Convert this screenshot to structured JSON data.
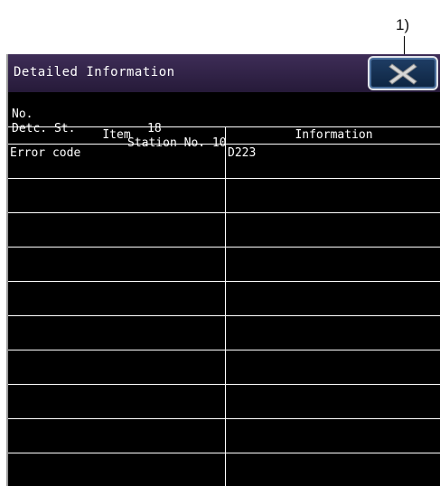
{
  "annotation": {
    "callout_label": "1)"
  },
  "window": {
    "title": "Detailed Information",
    "close_icon": "close-x-icon"
  },
  "info": {
    "no_label": "No.",
    "no_value": "18",
    "detc_label": "Detc. St.",
    "detc_value": "Station No. 10"
  },
  "table": {
    "headers": {
      "item": "Item",
      "information": "Information"
    },
    "rows": [
      {
        "item": "Error code",
        "information": "D223"
      },
      {
        "item": "",
        "information": ""
      },
      {
        "item": "",
        "information": ""
      },
      {
        "item": "",
        "information": ""
      },
      {
        "item": "",
        "information": ""
      },
      {
        "item": "",
        "information": ""
      },
      {
        "item": "",
        "information": ""
      },
      {
        "item": "",
        "information": ""
      },
      {
        "item": "",
        "information": ""
      },
      {
        "item": "",
        "information": ""
      }
    ]
  },
  "colors": {
    "titlebar": "#2f2146",
    "screen_background": "#000000",
    "text": "#ffffff",
    "close_button": "#163257"
  }
}
